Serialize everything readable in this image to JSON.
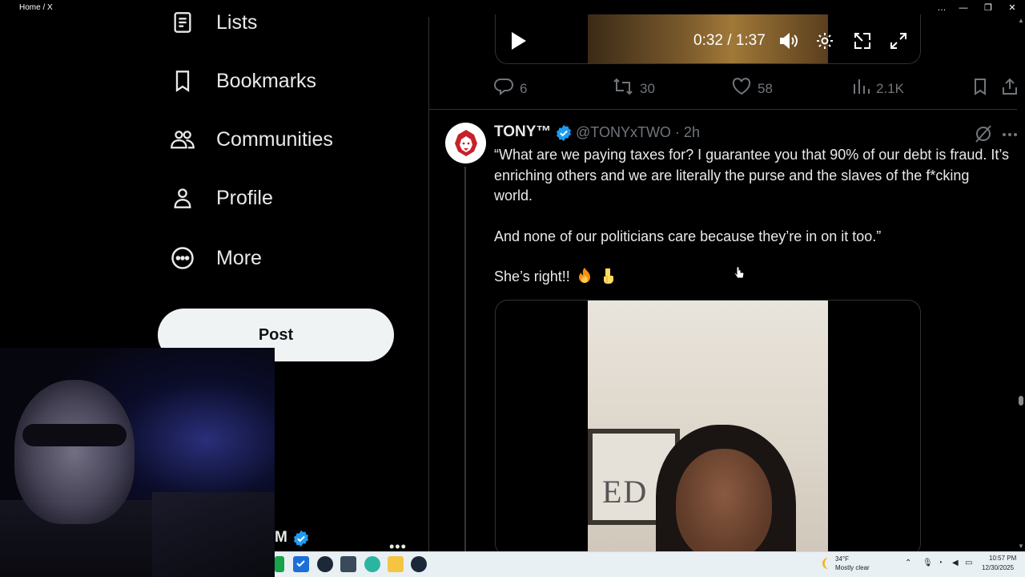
{
  "window": {
    "title": "Home / X",
    "controls": [
      "…",
      "—",
      "❐",
      "✕"
    ]
  },
  "nav": {
    "items": [
      {
        "label": "Lists",
        "icon": "list-icon"
      },
      {
        "label": "Bookmarks",
        "icon": "bookmark-icon"
      },
      {
        "label": "Communities",
        "icon": "communities-icon"
      },
      {
        "label": "Profile",
        "icon": "profile-icon"
      },
      {
        "label": "More",
        "icon": "more-circle-icon"
      }
    ],
    "post_label": "Post"
  },
  "account": {
    "name_visible": "M",
    "more": "•••"
  },
  "video1": {
    "time": "0:32 / 1:37"
  },
  "actions": {
    "replies": "6",
    "reposts": "30",
    "likes": "58",
    "views": "2.1K"
  },
  "tweet": {
    "author": "TONY™",
    "handle": "@TONYxTWO · 2h",
    "para1": "“What are we paying taxes for? I guarantee you that 90% of our debt is fraud. It’s enriching others and we are literally the purse and the slaves of the f*cking world.",
    "para2": "And none of our politicians care because they’re in on it too.”",
    "para3": "She’s right!!"
  },
  "video2": {
    "sign_text": "ED"
  },
  "taskbar": {
    "weather_temp": "34°F",
    "weather_desc": "Mostly clear",
    "time": "10:57 PM",
    "date": "12/30/2025"
  },
  "colors": {
    "accent_verified": "#1d9bf0",
    "text": "#e7e9ea",
    "muted": "#71767b",
    "border": "#2f3336"
  }
}
